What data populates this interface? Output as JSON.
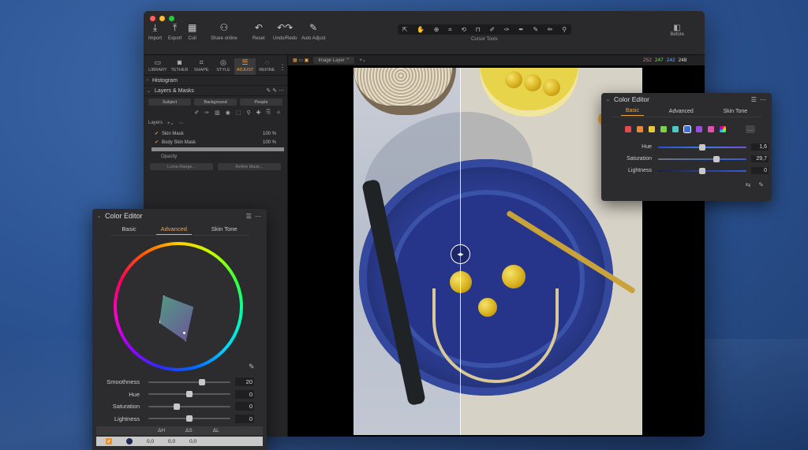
{
  "titlebar": {
    "buttons": [
      {
        "icon": "import-icon",
        "label": "Import"
      },
      {
        "icon": "export-icon",
        "label": "Export"
      },
      {
        "icon": "cull-icon",
        "label": "Cull"
      },
      {
        "icon": "share-icon",
        "label": "Share online"
      },
      {
        "icon": "reset-icon",
        "label": "Reset"
      },
      {
        "icon": "undo-redo-icon",
        "label": "Undo/Redo"
      },
      {
        "icon": "auto-adjust-icon",
        "label": "Auto Adjust"
      }
    ],
    "cursor_tools_label": "Cursor Tools",
    "before_label": "Before"
  },
  "tooltabs": [
    {
      "label": "LIBRARY"
    },
    {
      "label": "TETHER"
    },
    {
      "label": "SHAPE"
    },
    {
      "label": "STYLE"
    },
    {
      "label": "ADJUST"
    },
    {
      "label": "REFINE"
    }
  ],
  "left_panel": {
    "histogram_label": "Histogram",
    "layers_masks_label": "Layers & Masks",
    "mask_buttons": [
      "Subject",
      "Background",
      "People"
    ],
    "layers_label": "Layers",
    "layers": [
      {
        "name": "Skin Mask",
        "pct": "100 %"
      },
      {
        "name": "Body Skin Mask",
        "pct": "100 %"
      }
    ],
    "opacity_label": "Opacity",
    "luma_range_label": "Luma Range...",
    "refine_mask_label": "Refine Mask..."
  },
  "viewer": {
    "layer_select": "Image Layer",
    "rgb_values": {
      "r": "252",
      "g": "247",
      "b": "242",
      "l": "248"
    }
  },
  "ce_small": {
    "title": "Color Editor",
    "tabs": [
      "Basic",
      "Advanced",
      "Skin Tone"
    ],
    "active_tab": "Basic",
    "swatch_colors": [
      "#e5484d",
      "#e68a3a",
      "#e5c93a",
      "#7cd14b",
      "#4cc9c0",
      "#3b6fd9",
      "#9b4de0",
      "#e04fb4"
    ],
    "sliders": [
      {
        "label": "Hue",
        "value": "1,6",
        "pos": 0.5
      },
      {
        "label": "Saturation",
        "value": "29,7",
        "pos": 0.66
      },
      {
        "label": "Lightness",
        "value": "0",
        "pos": 0.5
      }
    ]
  },
  "ce_big": {
    "title": "Color Editor",
    "tabs": [
      "Basic",
      "Advanced",
      "Skin Tone"
    ],
    "active_tab": "Advanced",
    "sliders": [
      {
        "label": "Smoothness",
        "value": "20",
        "pos": 0.65
      },
      {
        "label": "Hue",
        "value": "0",
        "pos": 0.5
      },
      {
        "label": "Saturation",
        "value": "0",
        "pos": 0.35
      },
      {
        "label": "Lightness",
        "value": "0",
        "pos": 0.5
      }
    ],
    "table_headers": [
      "ΔH",
      "ΔS",
      "ΔL"
    ],
    "table_row": [
      "0,0",
      "0,0",
      "0,0"
    ]
  }
}
